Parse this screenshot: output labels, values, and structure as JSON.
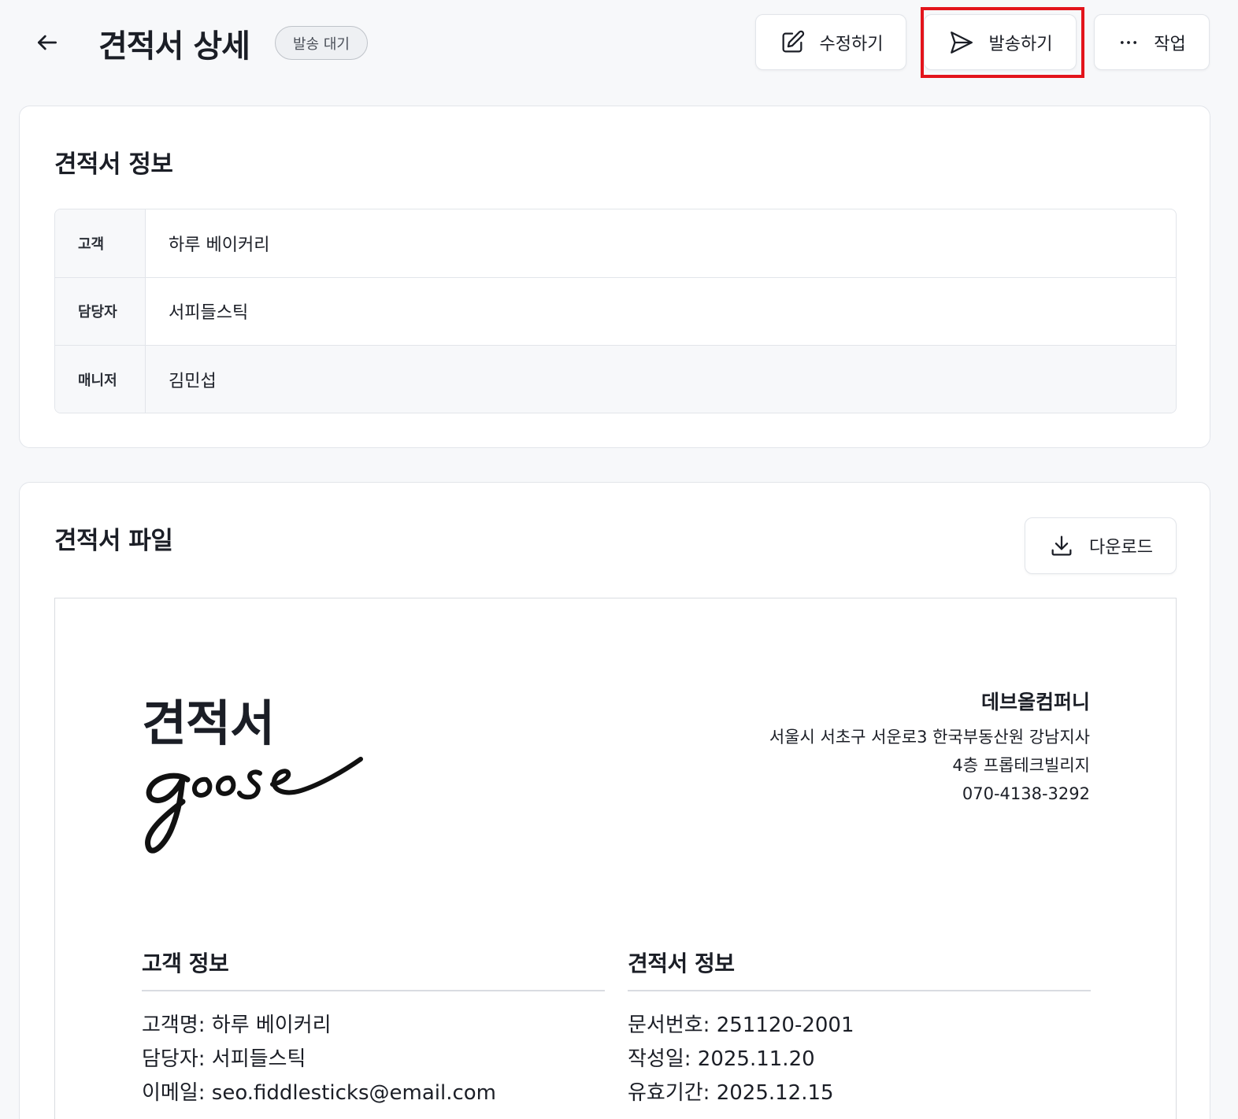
{
  "header": {
    "title": "견적서 상세",
    "status": "발송 대기",
    "edit_label": "수정하기",
    "send_label": "발송하기",
    "more_label": "작업"
  },
  "info_card": {
    "title": "견적서 정보",
    "rows": [
      {
        "label": "고객",
        "value": "하루 베이커리"
      },
      {
        "label": "담당자",
        "value": "서피들스틱"
      },
      {
        "label": "매니저",
        "value": "김민섭"
      }
    ]
  },
  "file_card": {
    "title": "견적서 파일",
    "download_label": "다운로드",
    "document": {
      "title": "견적서",
      "signature_text": "goose",
      "company": {
        "name": "데브올컴퍼니",
        "address1": "서울시 서초구 서운로3 한국부동산원 강남지사",
        "address2": "4층 프롭테크빌리지",
        "phone": "070-4138-3292"
      },
      "customer_section": {
        "heading": "고객 정보",
        "lines": [
          "고객명: 하루 베이커리",
          "담당자: 서피들스틱",
          "이메일: seo.fiddlesticks@email.com"
        ]
      },
      "quote_section": {
        "heading": "견적서 정보",
        "lines": [
          "문서번호: 251120-2001",
          "작성일: 2025.11.20",
          "유효기간: 2025.12.15"
        ]
      }
    }
  },
  "colors": {
    "highlight": "#e3141b",
    "background": "#f7f8fa",
    "text": "#1b1e26"
  }
}
